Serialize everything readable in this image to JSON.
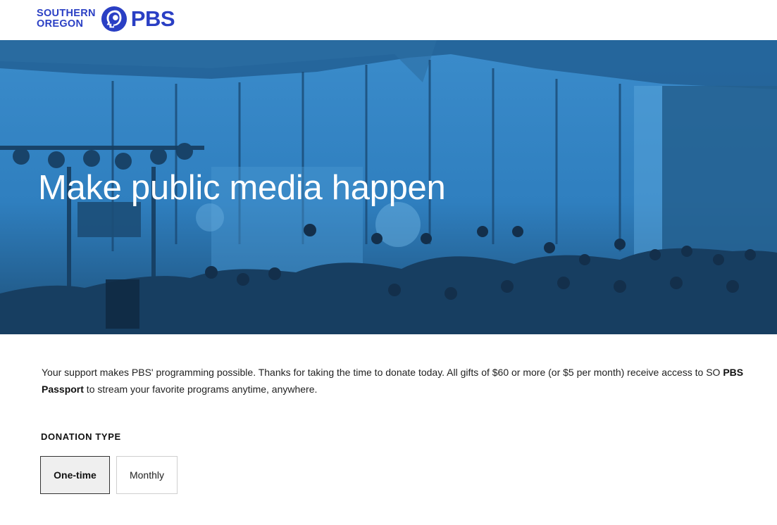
{
  "header": {
    "logo_line1": "SOUTHERN",
    "logo_line2": "OREGON",
    "logo_brand": "PBS",
    "logo_icon": "pbs-head-icon"
  },
  "hero": {
    "title": "Make public media happen",
    "background_color": "#2f82c1"
  },
  "intro": {
    "text_before": "Your support makes PBS' programming possible. Thanks for taking the time to donate today. All gifts of $60 or more (or $5 per month) receive access to SO ",
    "bold": "PBS Passport",
    "text_after": " to stream your favorite programs anytime, anywhere."
  },
  "donation": {
    "label": "DONATION TYPE",
    "options": [
      "One-time",
      "Monthly"
    ],
    "selected": "One-time"
  },
  "colors": {
    "brand": "#2a3fc4",
    "hero_tint": "#2f82c1"
  }
}
